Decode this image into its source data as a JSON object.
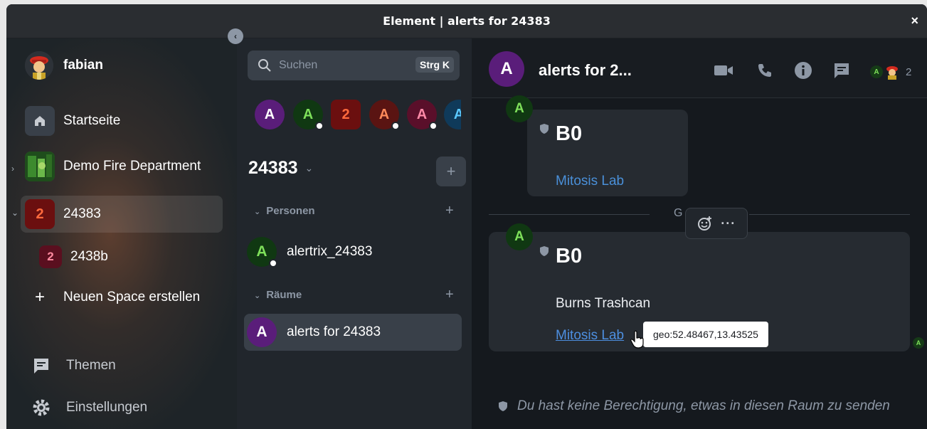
{
  "window": {
    "title": "Element | alerts for 24383",
    "close": "×"
  },
  "user": {
    "name": "fabian"
  },
  "spaces": {
    "home": "Startseite",
    "items": [
      {
        "label": "Demo Fire Department"
      },
      {
        "label": "24383",
        "badge": "2"
      },
      {
        "label": "2438b",
        "badge": "2"
      }
    ],
    "create": "Neuen Space erstellen",
    "threads": "Themen",
    "settings": "Einstellungen"
  },
  "search": {
    "placeholder": "Suchen",
    "shortcut": "Strg K"
  },
  "bubbles": [
    "A",
    "A",
    "2",
    "A",
    "A",
    "A"
  ],
  "space_header": {
    "title": "24383"
  },
  "sections": {
    "people": "Personen",
    "rooms": "Räume"
  },
  "people": [
    {
      "initial": "A",
      "name": "alertrix_24383"
    }
  ],
  "rooms": [
    {
      "initial": "A",
      "name": "alerts for 24383"
    }
  ],
  "room_header": {
    "initial": "A",
    "title": "alerts for 2...",
    "member_count": "2",
    "member_initial": "A"
  },
  "messages": [
    {
      "sender_initial": "A",
      "title": "B0",
      "link": "Mitosis Lab"
    },
    {
      "sender_initial": "A",
      "title": "B0",
      "text": "Burns Trashcan",
      "link": "Mitosis Lab"
    }
  ],
  "divider_text": "G",
  "tooltip": "geo:52.48467,13.43525",
  "read_receipt": "A",
  "notice": "Du hast keine Berechtigung, etwas in diesen Raum zu senden",
  "colors": {
    "accent_purple": "#5a1d7a",
    "green_avatar": "#103812",
    "link": "#4a90d9",
    "badge_red": "#6b0f0f"
  }
}
